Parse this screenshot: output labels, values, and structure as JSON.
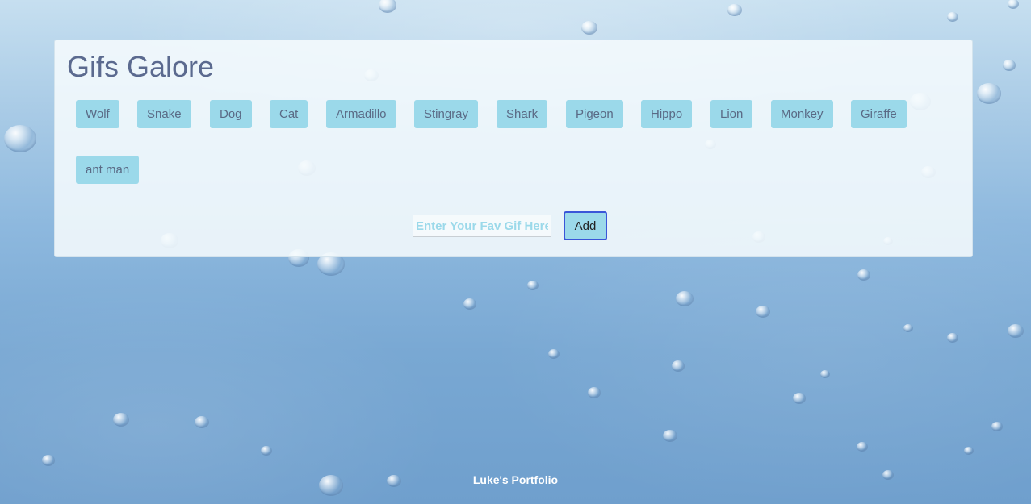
{
  "header": {
    "title": "Gifs Galore"
  },
  "topics": [
    {
      "label": "Wolf"
    },
    {
      "label": "Snake"
    },
    {
      "label": "Dog"
    },
    {
      "label": "Cat"
    },
    {
      "label": "Armadillo"
    },
    {
      "label": "Stingray"
    },
    {
      "label": "Shark"
    },
    {
      "label": "Pigeon"
    },
    {
      "label": "Hippo"
    },
    {
      "label": "Lion"
    },
    {
      "label": "Monkey"
    },
    {
      "label": "Giraffe"
    },
    {
      "label": "ant man"
    }
  ],
  "form": {
    "input_value": "",
    "placeholder": "Enter Your Fav Gif Here",
    "add_label": "Add"
  },
  "footer": {
    "link_label": "Luke's Portfolio"
  },
  "colors": {
    "button_bg": "#9bd9ea",
    "title": "#5b6a8f",
    "add_border": "#3a56d8"
  }
}
